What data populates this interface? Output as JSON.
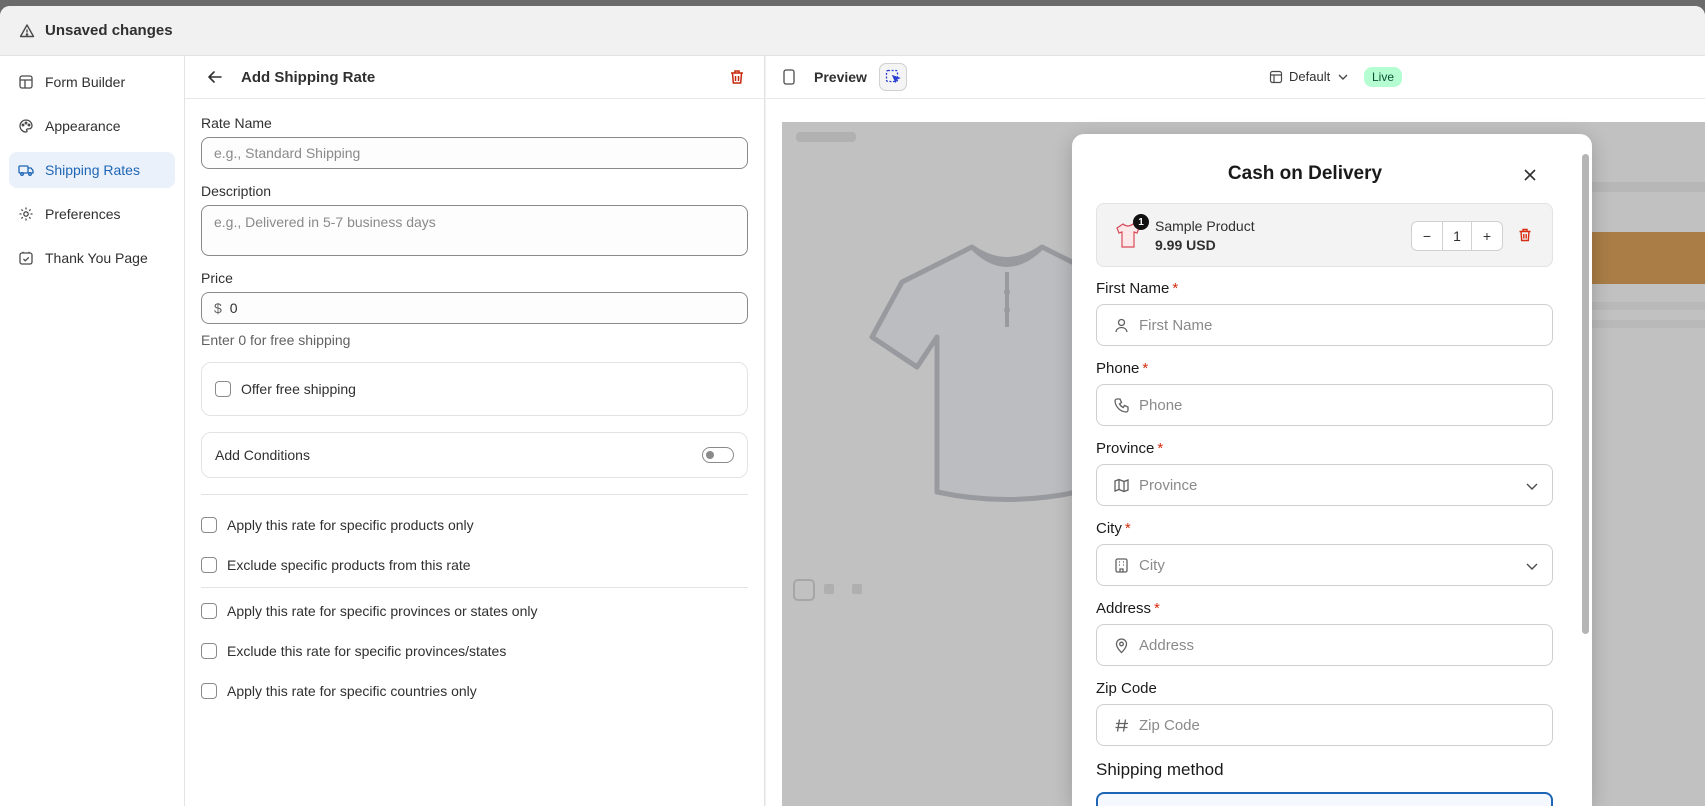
{
  "topbar": {
    "title": "Unsaved changes",
    "icon": "warning-icon"
  },
  "nav": {
    "items": [
      {
        "label": "Form Builder",
        "icon": "form-builder-icon",
        "active": false
      },
      {
        "label": "Appearance",
        "icon": "palette-icon",
        "active": false
      },
      {
        "label": "Shipping Rates",
        "icon": "truck-icon",
        "active": true
      },
      {
        "label": "Preferences",
        "icon": "gear-icon",
        "active": false
      },
      {
        "label": "Thank You Page",
        "icon": "thank-you-icon",
        "active": false
      }
    ]
  },
  "editor": {
    "title": "Add Shipping Rate",
    "rate_name": {
      "label": "Rate Name",
      "placeholder": "e.g., Standard Shipping",
      "value": ""
    },
    "description": {
      "label": "Description",
      "placeholder": "e.g., Delivered in 5-7 business days",
      "value": ""
    },
    "price": {
      "label": "Price",
      "currency": "$",
      "value": "0",
      "help": "Enter 0 for free shipping"
    },
    "free_shipping": {
      "label": "Offer free shipping",
      "checked": false
    },
    "conditions": {
      "label": "Add Conditions",
      "enabled": false
    },
    "condition_options": [
      {
        "label": "Apply this rate for specific products only",
        "checked": false
      },
      {
        "label": "Exclude specific products from this rate",
        "checked": false
      },
      {
        "label": "Apply this rate for specific provinces or states only",
        "checked": false
      },
      {
        "label": "Exclude this rate for specific provinces/states",
        "checked": false
      },
      {
        "label": "Apply this rate for specific countries only",
        "checked": false
      }
    ]
  },
  "preview": {
    "title": "Preview",
    "theme": "Default",
    "status": "Live",
    "modal": {
      "title": "Cash on Delivery",
      "product": {
        "name": "Sample Product",
        "price": "9.99 USD",
        "quantity": "1",
        "badge": "1"
      },
      "fields": [
        {
          "label": "First Name",
          "placeholder": "First Name",
          "required": true,
          "icon": "person-icon",
          "dropdown": false
        },
        {
          "label": "Phone",
          "placeholder": "Phone",
          "required": true,
          "icon": "phone-icon",
          "dropdown": false
        },
        {
          "label": "Province",
          "placeholder": "Province",
          "required": true,
          "icon": "map-icon",
          "dropdown": true
        },
        {
          "label": "City",
          "placeholder": "City",
          "required": true,
          "icon": "building-icon",
          "dropdown": true
        },
        {
          "label": "Address",
          "placeholder": "Address",
          "required": true,
          "icon": "location-pin-icon",
          "dropdown": false
        },
        {
          "label": "Zip Code",
          "placeholder": "Zip Code",
          "required": false,
          "icon": "hash-icon",
          "dropdown": false
        }
      ],
      "shipping_heading": "Shipping method"
    }
  },
  "colors": {
    "accent": "#1e66b5",
    "danger": "#d72c0d",
    "live_bg": "#b4fed2"
  }
}
